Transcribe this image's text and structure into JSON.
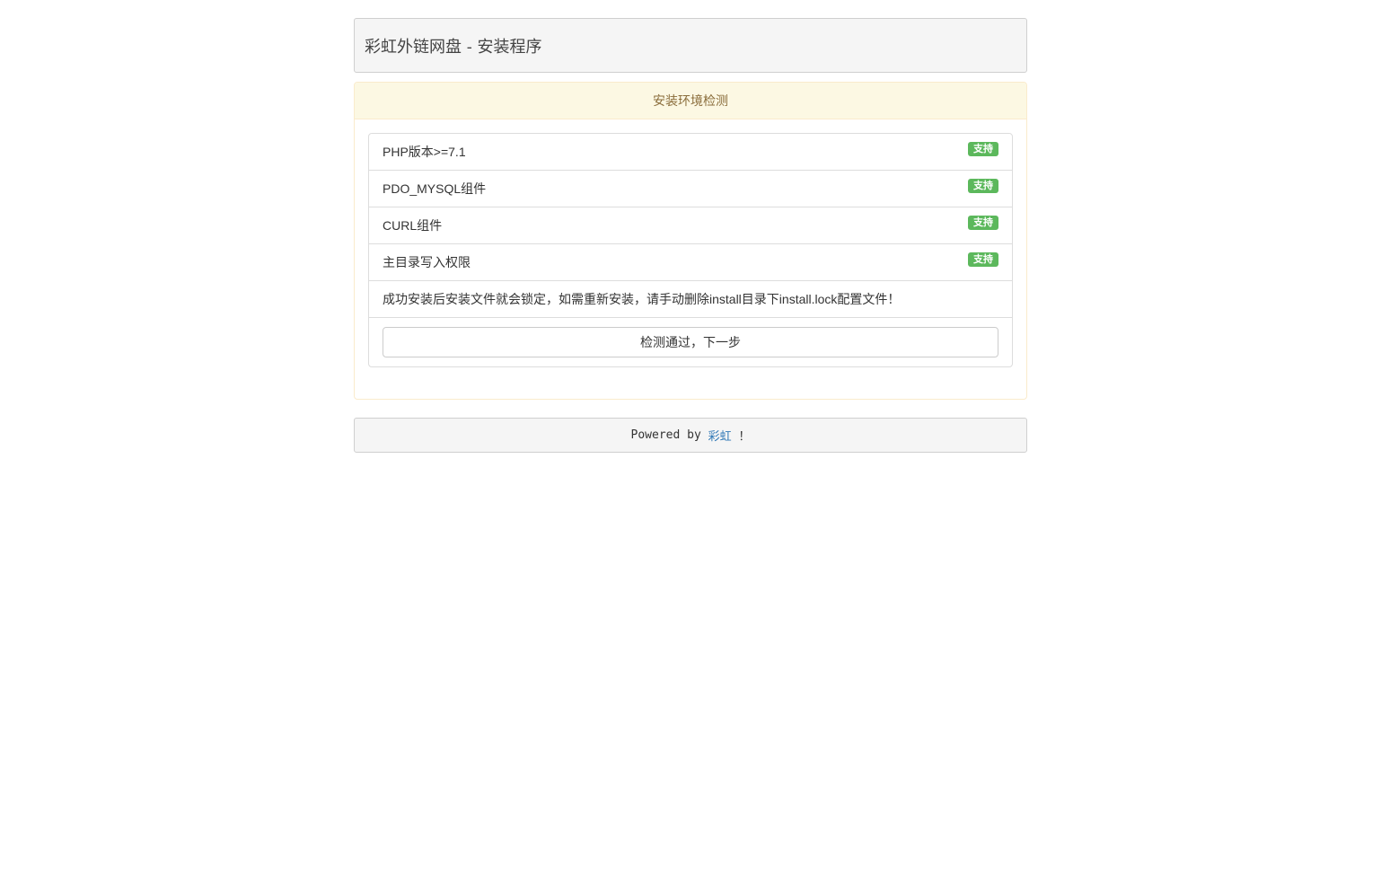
{
  "header": {
    "title": "彩虹外链网盘 - 安装程序"
  },
  "panel": {
    "heading": "安装环境检测",
    "checks": [
      {
        "label": "PHP版本>=7.1",
        "status": "支持"
      },
      {
        "label": "PDO_MYSQL组件",
        "status": "支持"
      },
      {
        "label": "CURL组件",
        "status": "支持"
      },
      {
        "label": "主目录写入权限",
        "status": "支持"
      }
    ],
    "notice": "成功安装后安装文件就会锁定，如需重新安装，请手动删除install目录下install.lock配置文件！",
    "next_button": "检测通过，下一步"
  },
  "footer": {
    "prefix": "Powered by ",
    "link_text": "彩虹",
    "suffix": " ！"
  },
  "colors": {
    "badge_success": "#5cb85c",
    "warning_heading_bg": "#fcf8e3",
    "warning_heading_text": "#8a6d3b",
    "link": "#337ab7"
  }
}
